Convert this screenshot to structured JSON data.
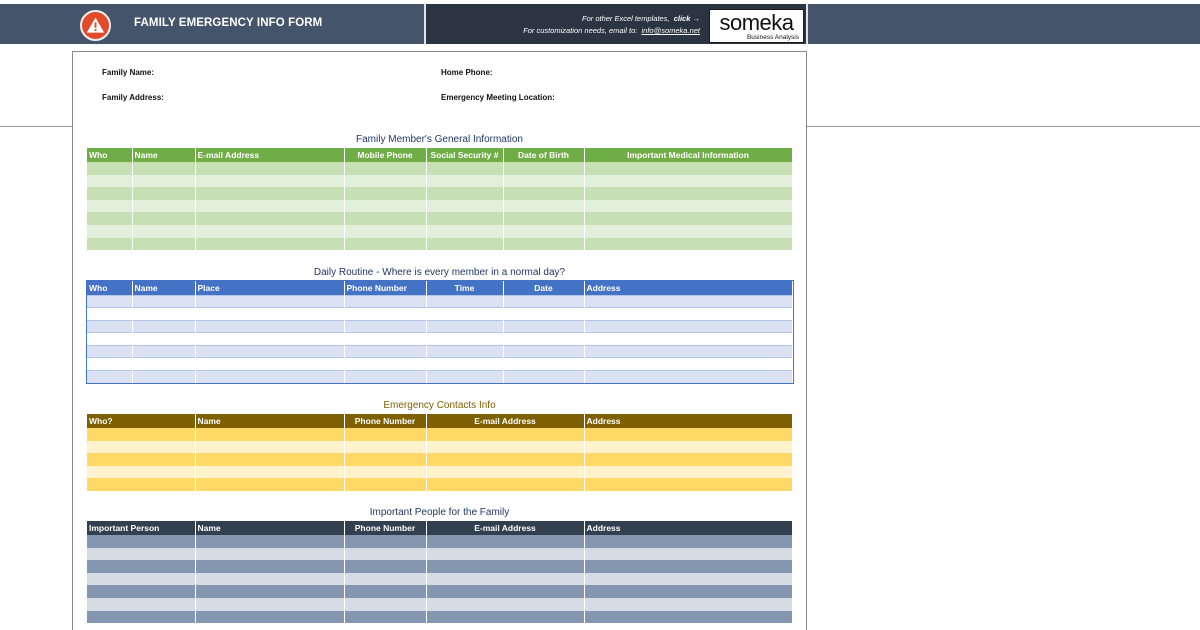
{
  "header": {
    "title": "FAMILY EMERGENCY INFO FORM",
    "icon": "warning-icon",
    "promo_line1_prefix": "For other Excel templates,",
    "promo_line1_click": "click",
    "promo_line1_arrow": "→",
    "promo_line2_prefix": "For customization needs, email to:",
    "promo_email": "info@someka.net",
    "logo_text": "someka",
    "logo_subtitle": "Business Analysis"
  },
  "colors": {
    "header_bg": "#44546a",
    "warning_red": "#e24a2c",
    "green": "#70ad47",
    "blue": "#4472c4",
    "brown": "#7f6000",
    "yellow": "#ffd966",
    "slate": "#323f4f"
  },
  "family_fields": {
    "family_name": "Family Name:",
    "family_address": "Family Address:",
    "home_phone": "Home Phone:",
    "emergency_meeting_location": "Emergency Meeting Location:"
  },
  "sections": {
    "general": {
      "title": "Family Member's General Information",
      "columns": [
        "Who",
        "Name",
        "E-mail Address",
        "Mobile Phone",
        "Social Security #",
        "Date of Birth",
        "Important Medical Information"
      ]
    },
    "routine": {
      "title": "Daily Routine - Where is every member in a normal day?",
      "columns": [
        "Who",
        "Name",
        "Place",
        "Phone Number",
        "Time",
        "Date",
        "Address"
      ]
    },
    "contacts": {
      "title": "Emergency Contacts Info",
      "columns": [
        "Who?",
        "Name",
        "Phone Number",
        "E-mail Address",
        "Address"
      ]
    },
    "people": {
      "title": "Important People for the Family",
      "columns": [
        "Important Person",
        "Name",
        "Phone Number",
        "E-mail Address",
        "Address"
      ]
    }
  }
}
